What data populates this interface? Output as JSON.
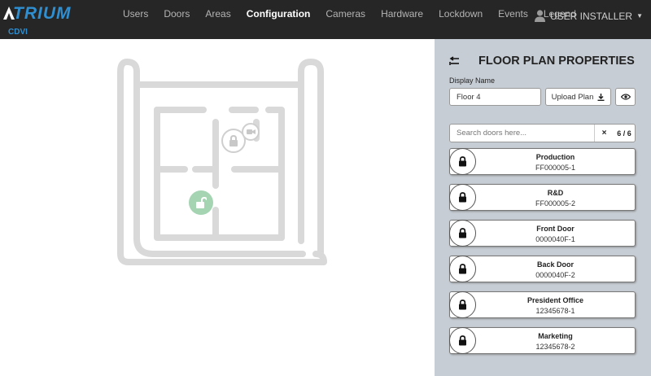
{
  "app": {
    "logo_text": "TRIUM",
    "sublogo": "CDVI",
    "brand_color": "#2f8fd1"
  },
  "nav": {
    "items": [
      {
        "label": "Users",
        "active": false
      },
      {
        "label": "Doors",
        "active": false
      },
      {
        "label": "Areas",
        "active": false
      },
      {
        "label": "Configuration",
        "active": true
      },
      {
        "label": "Cameras",
        "active": false
      },
      {
        "label": "Hardware",
        "active": false
      },
      {
        "label": "Lockdown",
        "active": false
      },
      {
        "label": "Events",
        "active": false
      },
      {
        "label": "Legend",
        "active": false
      }
    ],
    "user_label": "USER INSTALLER"
  },
  "panel": {
    "title": "FLOOR PLAN PROPERTIES",
    "display_name_label": "Display Name",
    "display_name_value": "Floor 4",
    "upload_label": "Upload Plan",
    "search_placeholder": "Search doors here...",
    "clear_label": "×",
    "count": "6 / 6"
  },
  "doors": [
    {
      "name": "Production",
      "id": "FF000005-1"
    },
    {
      "name": "R&D",
      "id": "FF000005-2"
    },
    {
      "name": "Front Door",
      "id": "0000040F-1"
    },
    {
      "name": "Back Door",
      "id": "0000040F-2"
    },
    {
      "name": "President Office",
      "id": "12345678-1"
    },
    {
      "name": "Marketing",
      "id": "12345678-2"
    }
  ],
  "floorplan": {
    "icons": [
      "locked-door-icon",
      "camera-icon",
      "unlocked-door-icon"
    ],
    "unlocked_color": "#a5d4b3"
  }
}
